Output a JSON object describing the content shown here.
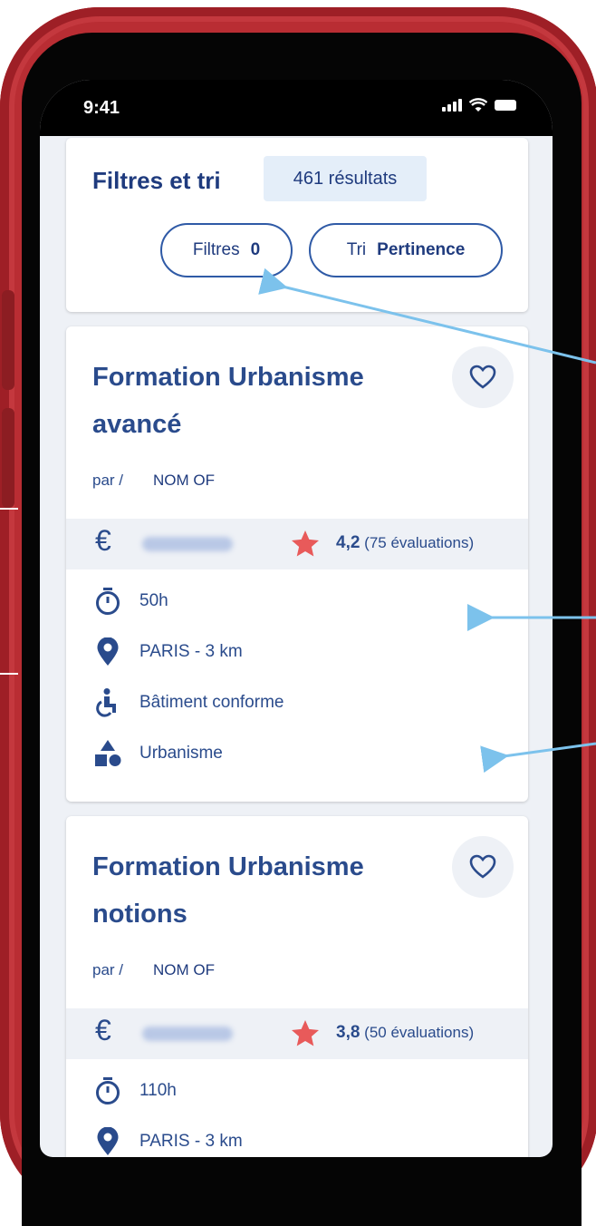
{
  "status": {
    "time": "9:41"
  },
  "filters": {
    "title": "Filtres et tri",
    "results": "461 résultats",
    "filter_label": "Filtres",
    "filter_count": "0",
    "sort_label": "Tri",
    "sort_value": "Pertinence"
  },
  "courses": [
    {
      "title_line1": "Formation Urbanisme",
      "title_line2": "avancé",
      "par": "par /",
      "provider": "NOM OF",
      "currency": "€",
      "rating_value": "4,2",
      "rating_count": "(75 évaluations)",
      "duration": "50h",
      "location": "PARIS - 3 km",
      "accessibility": "Bâtiment conforme",
      "category": "Urbanisme"
    },
    {
      "title_line1": "Formation Urbanisme",
      "title_line2": "notions",
      "par": "par /",
      "provider": "NOM OF",
      "currency": "€",
      "rating_value": "3,8",
      "rating_count": "(50 évaluations)",
      "duration": "110h",
      "location": "PARIS - 3 km"
    }
  ],
  "colors": {
    "accent": "#1f3b7e",
    "star": "#e85a5a",
    "annotation": "#7cc2ec",
    "phone": "#b92d33"
  },
  "icons": [
    "heart-icon",
    "euro-icon",
    "star-icon",
    "timer-icon",
    "location-pin-icon",
    "accessibility-icon",
    "category-shapes-icon"
  ]
}
